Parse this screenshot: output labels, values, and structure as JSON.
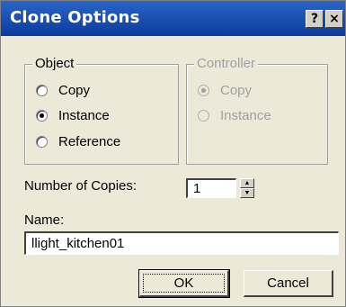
{
  "window": {
    "title": "Clone Options",
    "help_glyph": "?",
    "close_glyph": "×"
  },
  "object_group": {
    "legend": "Object",
    "options": [
      {
        "label": "Copy",
        "checked": false
      },
      {
        "label": "Instance",
        "checked": true
      },
      {
        "label": "Reference",
        "checked": false
      }
    ]
  },
  "controller_group": {
    "legend": "Controller",
    "disabled": true,
    "options": [
      {
        "label": "Copy",
        "checked": true
      },
      {
        "label": "Instance",
        "checked": false
      }
    ]
  },
  "copies": {
    "label": "Number of Copies:",
    "value": "1"
  },
  "name": {
    "label": "Name:",
    "value": "llight_kitchen01"
  },
  "buttons": {
    "ok": "OK",
    "cancel": "Cancel"
  }
}
